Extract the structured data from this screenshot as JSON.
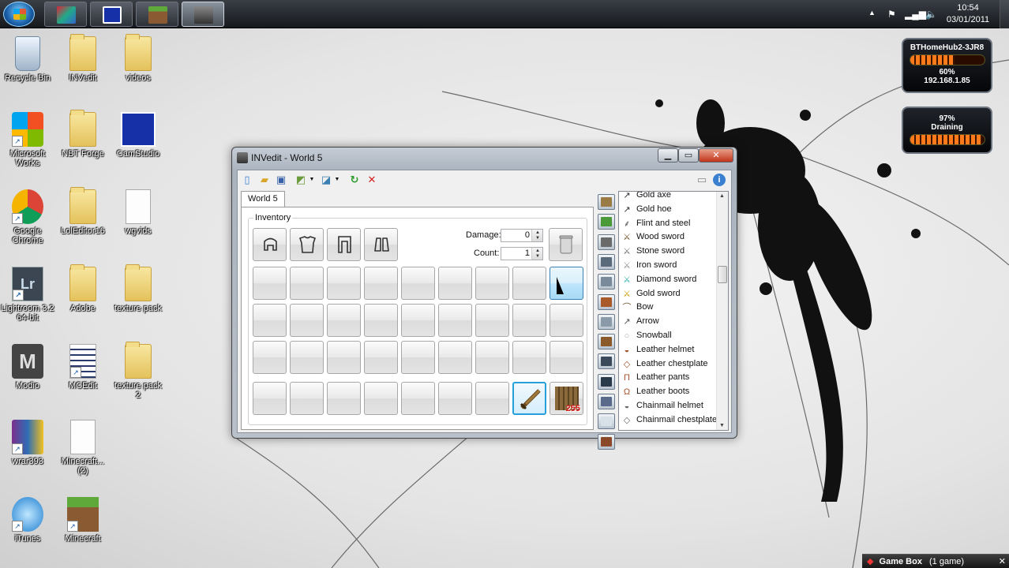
{
  "taskbar": {
    "buttons": [
      "PC Tools",
      "CamStudio",
      "Minecraft",
      "INVedit"
    ],
    "clock_time": "10:54",
    "clock_date": "03/01/2011"
  },
  "desktop_icons": [
    {
      "label": "Recycle Bin"
    },
    {
      "label": "INVedit"
    },
    {
      "label": "videos"
    },
    {
      "label": "Microsoft Works"
    },
    {
      "label": "NBT Forge"
    },
    {
      "label": "CamStudio"
    },
    {
      "label": "Google Chrome"
    },
    {
      "label": "LolEditor16"
    },
    {
      "label": "wgvids"
    },
    {
      "label": "Lightroom 3.2 64-bit"
    },
    {
      "label": "Adobe"
    },
    {
      "label": "texture pack"
    },
    {
      "label": "Modio"
    },
    {
      "label": "MCEdit"
    },
    {
      "label": "texture pack 2"
    },
    {
      "label": "wrar393"
    },
    {
      "label": "Minecraft... (2)"
    },
    {
      "label": "iTunes"
    },
    {
      "label": "Minecraft"
    }
  ],
  "gadgets": {
    "wifi": {
      "ssid": "BTHomeHub2-3JR8",
      "signal": "60%",
      "ip": "192.168.1.85",
      "signal_level": 0.6
    },
    "battery": {
      "percent": "97%",
      "status": "Draining",
      "level": 0.97
    }
  },
  "window": {
    "title": "INVedit - World 5",
    "tab": "World 5",
    "group_label": "Inventory",
    "damage_label": "Damage:",
    "damage_value": "0",
    "count_label": "Count:",
    "count_value": "1",
    "slot_count_text": "255"
  },
  "items": [
    {
      "name": "Gold axe"
    },
    {
      "name": "Gold hoe"
    },
    {
      "name": "Flint and steel"
    },
    {
      "name": "Wood sword"
    },
    {
      "name": "Stone sword"
    },
    {
      "name": "Iron sword"
    },
    {
      "name": "Diamond sword"
    },
    {
      "name": "Gold sword"
    },
    {
      "name": "Bow"
    },
    {
      "name": "Arrow"
    },
    {
      "name": "Snowball"
    },
    {
      "name": "Leather helmet"
    },
    {
      "name": "Leather chestplate"
    },
    {
      "name": "Leather pants"
    },
    {
      "name": "Leather boots"
    },
    {
      "name": "Chainmail helmet"
    },
    {
      "name": "Chainmail chestplate"
    }
  ],
  "gamebox": {
    "title": "Game Box",
    "count": "(1 game)"
  }
}
